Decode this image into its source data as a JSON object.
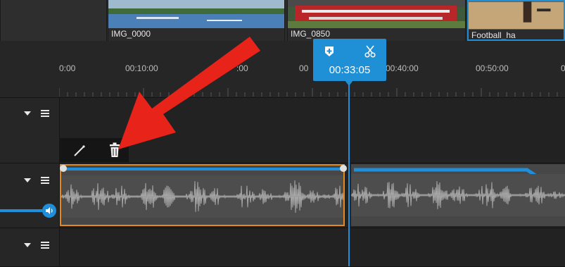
{
  "media_bin": {
    "items": [
      {
        "label": "IMG_0000"
      },
      {
        "label": "IMG_0850"
      },
      {
        "label": "Football_ha"
      }
    ]
  },
  "ruler": {
    "ticks": [
      "0:00",
      "00:10:00",
      ":00",
      "00",
      "00:40:00",
      "00:50:00",
      "0"
    ]
  },
  "playhead": {
    "time": "00:33:05",
    "icons": [
      "marker-add-icon",
      "scissors-icon"
    ]
  },
  "tracks": [
    {
      "name": "video-track-1"
    },
    {
      "name": "audio-track-1"
    },
    {
      "name": "track-3"
    }
  ],
  "clip_toolbar": {
    "icons": [
      "pencil-icon",
      "trash-icon"
    ]
  },
  "colors": {
    "accent": "#1f8fd6",
    "selection": "#e28a1e",
    "annotation": "#e8231a"
  }
}
